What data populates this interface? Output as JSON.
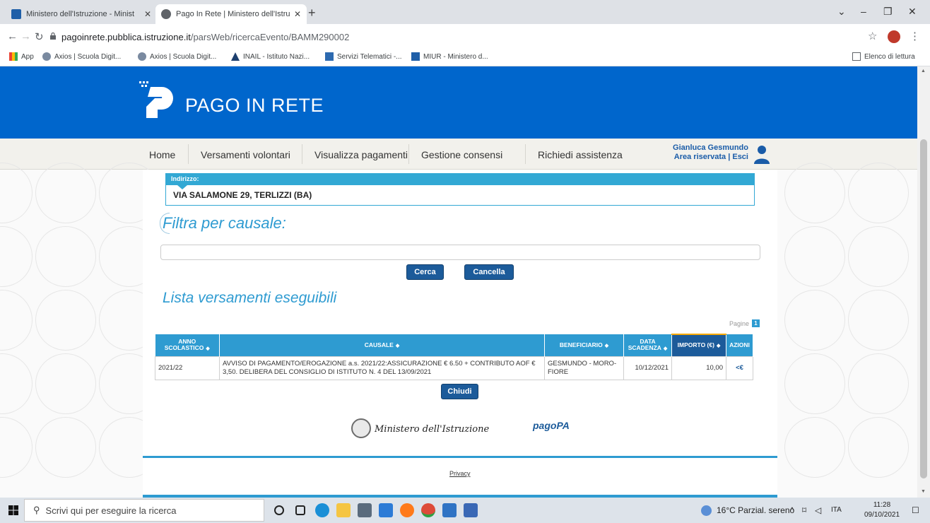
{
  "browser": {
    "tabs": [
      {
        "label": "Ministero dell'Istruzione - Minist",
        "active": false
      },
      {
        "label": "Pago In Rete | Ministero dell'Istru",
        "active": true
      }
    ],
    "url_host": "pagoinrete.pubblica.istruzione.it",
    "url_path": "/parsWeb/ricercaEvento/BAMM290002",
    "bookmarks": [
      {
        "label": "App",
        "icon": "apps-grid-icon"
      },
      {
        "label": "Axios | Scuola Digit...",
        "icon": "axios-icon"
      },
      {
        "label": "Axios | Scuola Digit...",
        "icon": "axios-icon"
      },
      {
        "label": "INAIL - Istituto Nazi...",
        "icon": "inail-icon"
      },
      {
        "label": "Servizi Telematici -...",
        "icon": "telematici-icon"
      },
      {
        "label": "MIUR - Ministero d...",
        "icon": "miur-icon"
      }
    ],
    "reading_list": "Elenco di lettura"
  },
  "site": {
    "logo_text": "PAGO IN RETE",
    "nav": [
      "Home",
      "Versamenti volontari",
      "Visualizza pagamenti",
      "Gestione consensi",
      "Richiedi assistenza"
    ],
    "user_name": "Gianluca Gesmundo",
    "user_area": "Area riservata | Esci"
  },
  "main": {
    "address_label": "Indirizzo:",
    "address_value": "VIA SALAMONE 29, TERLIZZI (BA)",
    "filter_title": "Filtra per causale:",
    "search_value": "",
    "btn_search": "Cerca",
    "btn_cancel": "Cancella",
    "list_title": "Lista versamenti eseguibili",
    "pages_label": "Pagine",
    "pages_current": "1",
    "table": {
      "headers": [
        "ANNO SCOLASTICO",
        "CAUSALE",
        "BENEFICIARIO",
        "DATA SCADENZA",
        "IMPORTO (€)",
        "AZIONI"
      ],
      "rows": [
        {
          "anno": "2021/22",
          "causale": "AVVISO DI PAGAMENTO/EROGAZIONE a.s. 2021/22:ASSICURAZIONE € 6.50 + CONTRIBUTO AOF € 3,50. DELIBERA DEL CONSIGLIO DI ISTITUTO N. 4 DEL 13/09/2021",
          "beneficiario": "GESMUNDO - MORO-FIORE",
          "scadenza": "10/12/2021",
          "importo": "10,00",
          "azione": "<€"
        }
      ]
    },
    "btn_close": "Chiudi",
    "footer_ministero": "Ministero dell'Istruzione",
    "footer_pagopa": "pagoPA",
    "privacy": "Privacy"
  },
  "taskbar": {
    "search_placeholder": "Scrivi qui per eseguire la ricerca",
    "weather": "16°C Parzial. sereno",
    "lang": "ITA",
    "time": "11:28",
    "date": "09/10/2021"
  }
}
